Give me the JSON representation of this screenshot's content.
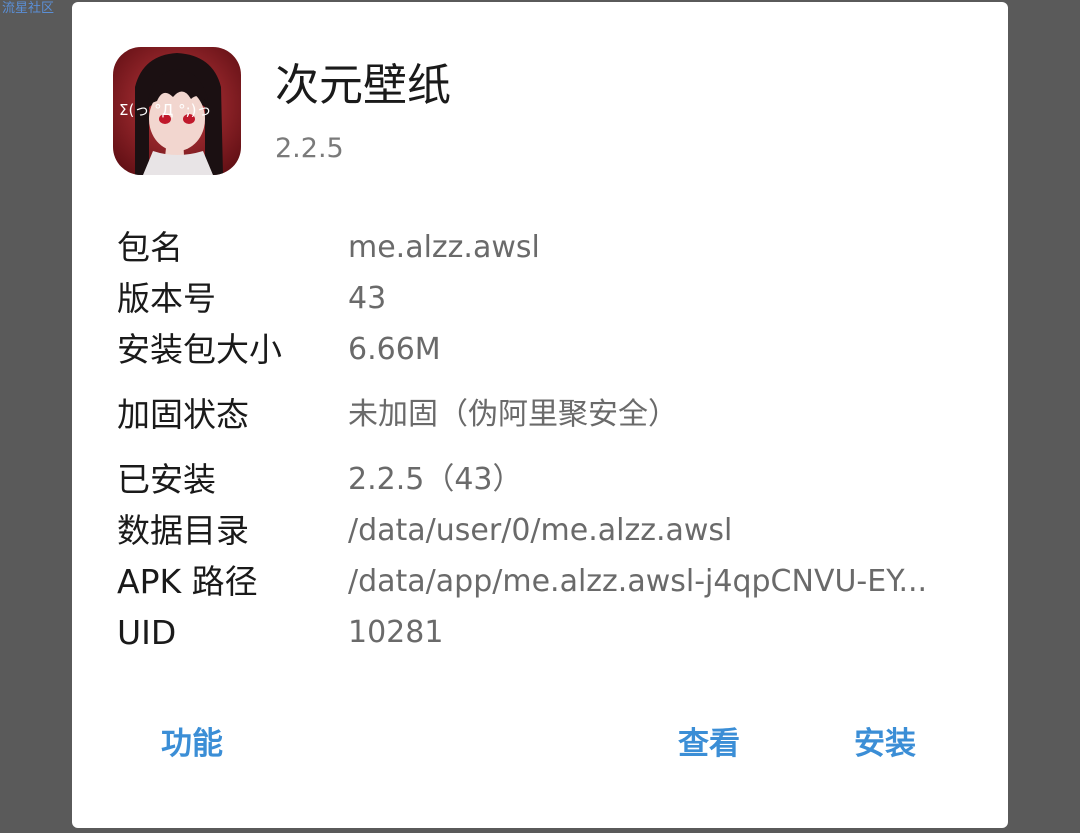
{
  "watermark": "流星社区",
  "app": {
    "title": "次元壁纸",
    "version": "2.2.5",
    "icon": "app-icon-anime-girl",
    "icon_text": "Σ(っ °Д °;)っ"
  },
  "info": [
    {
      "label": "包名",
      "value": "me.alzz.awsl"
    },
    {
      "label": "版本号",
      "value": "43"
    },
    {
      "label": "安装包大小",
      "value": "6.66M"
    },
    {
      "label": "加固状态",
      "value": "未加固（伪阿里聚安全）"
    },
    {
      "label": "已安装",
      "value": "2.2.5（43）"
    },
    {
      "label": "数据目录",
      "value": "/data/user/0/me.alzz.awsl"
    },
    {
      "label": "APK 路径",
      "value": "/data/app/me.alzz.awsl-j4qpCNVU-EY..."
    },
    {
      "label": "UID",
      "value": "10281"
    }
  ],
  "buttons": {
    "features": "功能",
    "view": "查看",
    "install": "安装"
  },
  "colors": {
    "accent": "#3b8ed6",
    "label": "#1a1a1a",
    "value": "#6a6a6a",
    "icon_bg": "#8a1c22"
  }
}
